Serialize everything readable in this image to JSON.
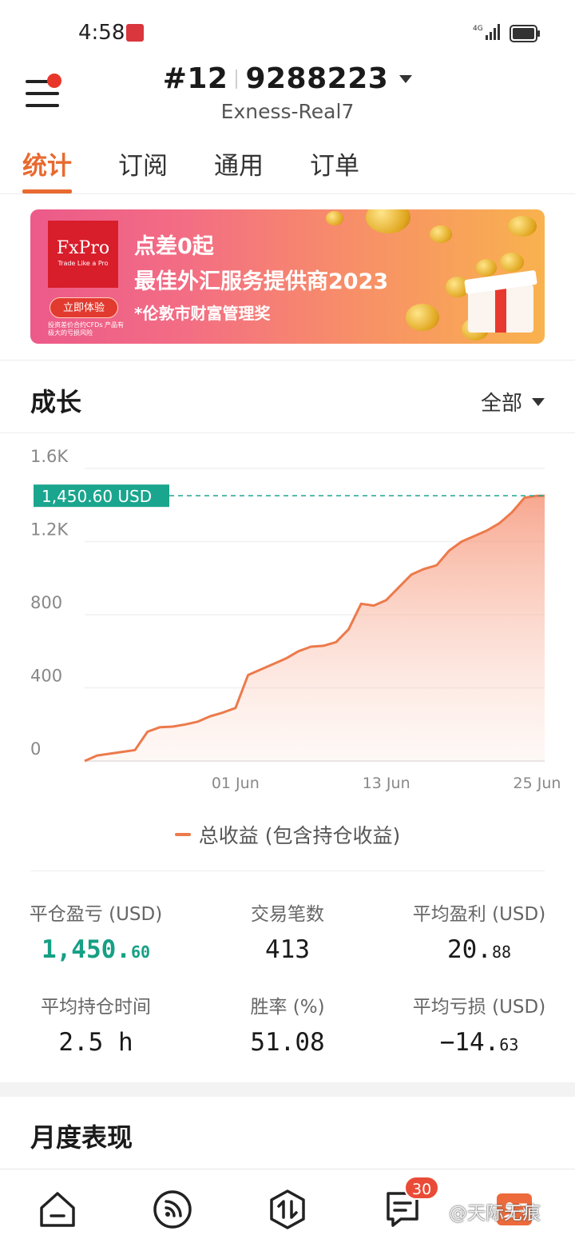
{
  "status_bar": {
    "time": "4:58",
    "network": "4G"
  },
  "header": {
    "account_prefix": "#12",
    "account_number": "9288223",
    "server": "Exness-Real7"
  },
  "tabs": [
    {
      "label": "统计",
      "active": true
    },
    {
      "label": "订阅",
      "active": false
    },
    {
      "label": "通用",
      "active": false
    },
    {
      "label": "订单",
      "active": false
    }
  ],
  "banner": {
    "logo_name": "FxPro",
    "logo_tagline": "Trade Like a Pro",
    "headline_1": "点差0起",
    "headline_2": "最佳外汇服务提供商2023",
    "headline_3": "*伦敦市财富管理奖",
    "button_label": "立即体验",
    "risk_text": "投资差价合约CFDs 产品有极大的亏损风险"
  },
  "growth": {
    "title": "成长",
    "filter_label": "全部"
  },
  "chart_data": {
    "type": "area",
    "current_label": "1,450.60 USD",
    "y_tick_labels": [
      "1.6K",
      "1.2K",
      "800",
      "400",
      "0"
    ],
    "y_ticks": [
      1600,
      1200,
      800,
      400,
      0
    ],
    "ylim": [
      0,
      1600
    ],
    "x_tick_labels": [
      "01 Jun",
      "13 Jun",
      "25 Jun"
    ],
    "x_ticks": [
      12,
      24,
      36
    ],
    "xlim": [
      0,
      36.6
    ],
    "series": [
      {
        "name": "总收益 (包含持仓收益)",
        "color": "#ec7a4b",
        "x": [
          0,
          1,
          2,
          3,
          4,
          5,
          6,
          7,
          8,
          9,
          10,
          11,
          12,
          13,
          14,
          15,
          16,
          17,
          18,
          19,
          20,
          21,
          22,
          23,
          24,
          25,
          26,
          27,
          28,
          29,
          30,
          31,
          32,
          33,
          34,
          35,
          36,
          36.6
        ],
        "values": [
          0,
          30,
          40,
          50,
          60,
          160,
          185,
          188,
          200,
          215,
          245,
          265,
          290,
          470,
          500,
          530,
          560,
          600,
          625,
          630,
          650,
          720,
          860,
          850,
          880,
          950,
          1020,
          1050,
          1070,
          1150,
          1200,
          1230,
          1260,
          1300,
          1360,
          1440,
          1450.6,
          1450.6
        ]
      }
    ],
    "grid": true
  },
  "stats": {
    "closed_pnl": {
      "label": "平仓盈亏 (USD)",
      "int": "1,450.",
      "dec": "60"
    },
    "trades": {
      "label": "交易笔数",
      "value": "413"
    },
    "avg_profit": {
      "label": "平均盈利 (USD)",
      "int": "20.",
      "dec": "88"
    },
    "avg_hold": {
      "label": "平均持仓时间",
      "value": "2.5 h"
    },
    "win_rate": {
      "label": "胜率 (%)",
      "value": "51.08"
    },
    "avg_loss": {
      "label": "平均亏损 (USD)",
      "int": "−14.",
      "dec": "63"
    }
  },
  "monthly": {
    "title": "月度表现"
  },
  "bottom_nav": {
    "messages_badge": "30"
  },
  "watermark": "@天际无痕",
  "colors": {
    "accent": "#e86a2f",
    "profit_green": "#16a085",
    "line": "#ec7a4b",
    "badge_red": "#ea4b36"
  }
}
